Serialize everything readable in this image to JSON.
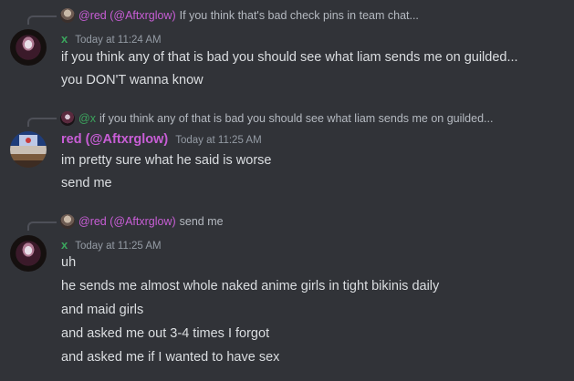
{
  "messages": [
    {
      "reply": {
        "name": "@red (@Aftxrglow)",
        "text": "If you think that's bad check pins in team chat..."
      },
      "author": "x",
      "timestamp": "Today at 11:24 AM",
      "lines": [
        "if you think any of that is bad you should see what liam sends me on guilded...",
        "you DON'T wanna know"
      ]
    },
    {
      "reply": {
        "name": "@x",
        "text": "if you think any of that is bad you should see what liam sends me on guilded..."
      },
      "author": "red (@Aftxrglow)",
      "timestamp": "Today at 11:25 AM",
      "lines": [
        "im pretty sure what he said is worse",
        "send me"
      ]
    },
    {
      "reply": {
        "name": "@red (@Aftxrglow)",
        "text": "send me"
      },
      "author": "x",
      "timestamp": "Today at 11:25 AM",
      "lines": [
        "uh",
        "he sends me almost whole naked anime girls in tight bikinis daily",
        "and maid girls",
        "and asked me out 3-4 times I forgot",
        "and asked me if I wanted to have sex"
      ]
    }
  ],
  "colors": {
    "background": "#313338",
    "text": "#dbdee1",
    "muted": "#949ba4",
    "username_pink": "#c85ed6",
    "username_green": "#3ba55d"
  },
  "icons": {
    "avatar_x": "avatar-x-icon",
    "avatar_red": "avatar-red-icon"
  }
}
